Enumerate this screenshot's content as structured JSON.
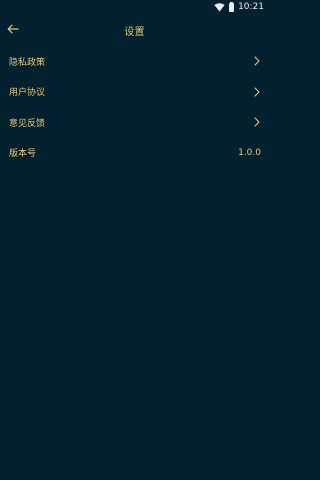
{
  "status_bar": {
    "time": "10:21",
    "wifi_icon": "wifi-icon",
    "battery_icon": "battery-icon"
  },
  "header": {
    "title": "设置",
    "back_icon": "arrow-left-icon"
  },
  "settings": {
    "items": [
      {
        "label": "隐私政策",
        "icon": "chevron-right-icon"
      },
      {
        "label": "用户协议",
        "icon": "chevron-right-icon"
      },
      {
        "label": "意见反馈",
        "icon": "chevron-right-icon"
      },
      {
        "label": "版本号",
        "value": "1.0.0"
      }
    ]
  },
  "colors": {
    "background": "#03202e",
    "accent": "#e7c867",
    "status_text": "#e9eef2"
  }
}
